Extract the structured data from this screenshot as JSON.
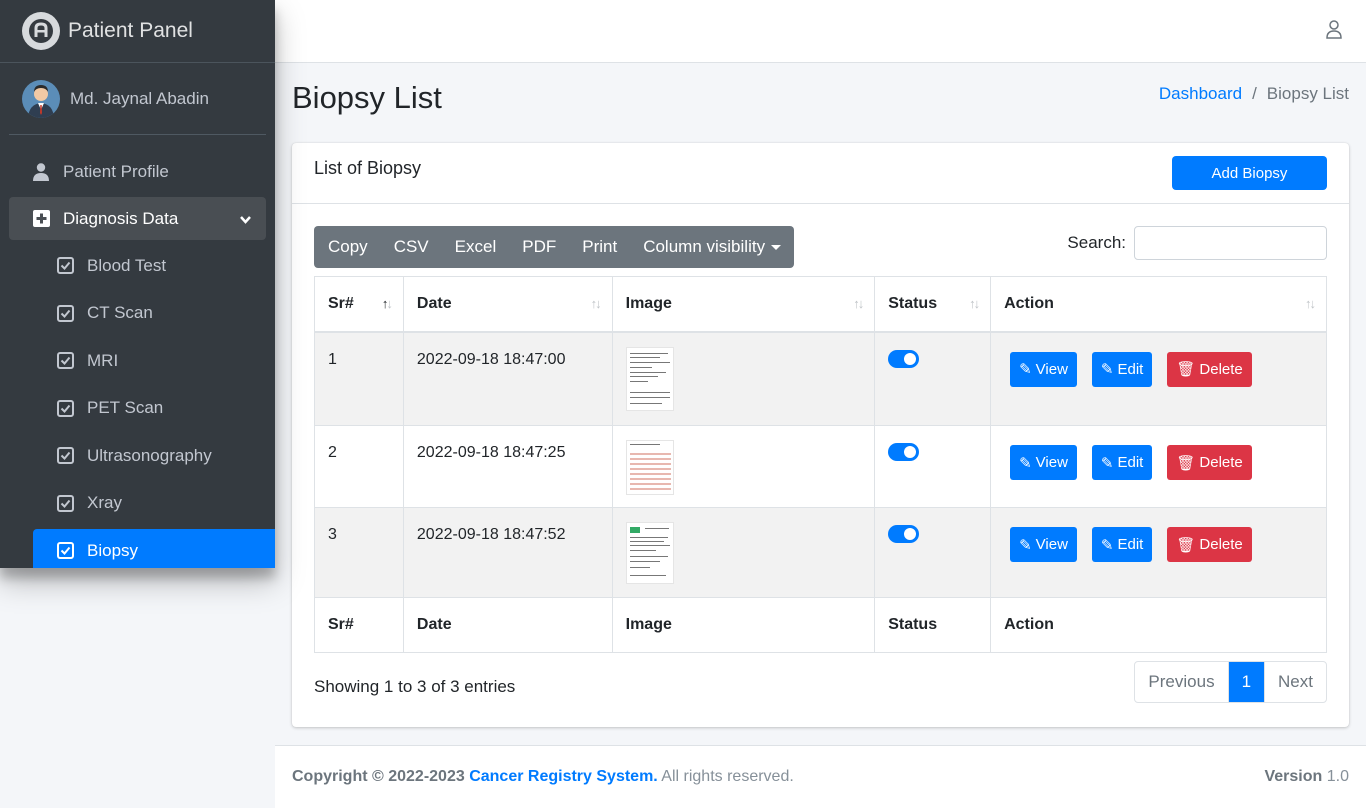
{
  "brand": {
    "title": "Patient Panel"
  },
  "user": {
    "name": "Md. Jaynal Abadin"
  },
  "sidebar": {
    "profile_label": "Patient Profile",
    "group_label": "Diagnosis Data",
    "items": [
      {
        "label": "Blood Test"
      },
      {
        "label": "CT Scan"
      },
      {
        "label": "MRI"
      },
      {
        "label": "PET Scan"
      },
      {
        "label": "Ultrasonography"
      },
      {
        "label": "Xray"
      },
      {
        "label": "Biopsy"
      }
    ]
  },
  "page": {
    "title": "Biopsy List"
  },
  "breadcrumb": {
    "home": "Dashboard",
    "sep": "/",
    "current": "Biopsy List"
  },
  "card": {
    "title": "List of Biopsy",
    "add_label": "Add Biopsy"
  },
  "toolbar": {
    "copy": "Copy",
    "csv": "CSV",
    "excel": "Excel",
    "pdf": "PDF",
    "print": "Print",
    "colvis": "Column visibility"
  },
  "search": {
    "label": "Search:"
  },
  "table": {
    "headers": {
      "sr": "Sr#",
      "date": "Date",
      "image": "Image",
      "status": "Status",
      "action": "Action"
    },
    "rows": [
      {
        "sr": "1",
        "date": "2022-09-18 18:47:00",
        "status_on": true
      },
      {
        "sr": "2",
        "date": "2022-09-18 18:47:25",
        "status_on": true
      },
      {
        "sr": "3",
        "date": "2022-09-18 18:47:52",
        "status_on": true
      }
    ],
    "actions": {
      "view": "View",
      "edit": "Edit",
      "delete": "Delete"
    }
  },
  "info": "Showing 1 to 3 of 3 entries",
  "pagination": {
    "previous": "Previous",
    "current": "1",
    "next": "Next"
  },
  "footer": {
    "copyright": "Copyright © 2022-2023",
    "brand": "Cancer Registry System.",
    "rights": "All rights reserved.",
    "version_label": "Version",
    "version": "1.0"
  },
  "colors": {
    "primary": "#007bff",
    "danger": "#dc3545",
    "sidebar": "#343a40",
    "secondary": "#6c757d"
  }
}
